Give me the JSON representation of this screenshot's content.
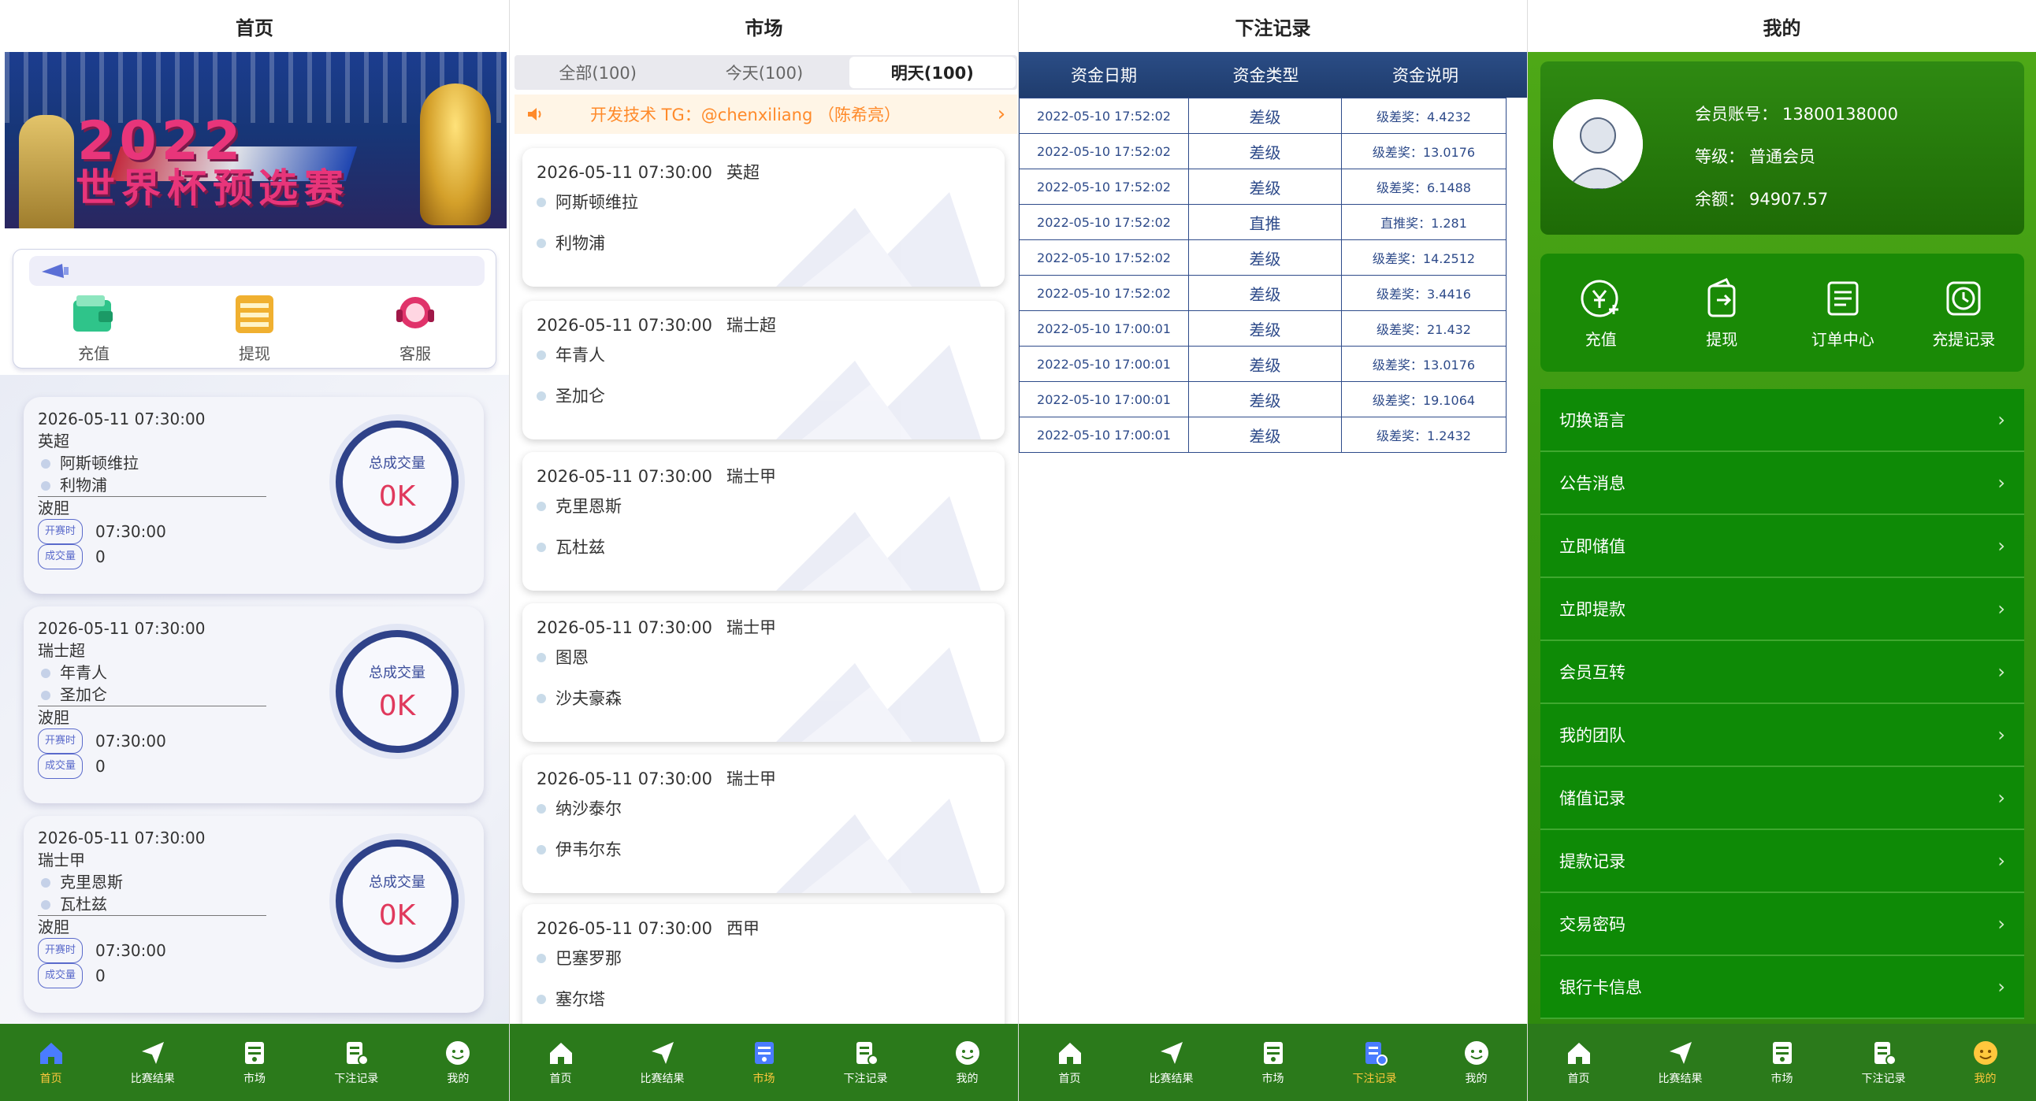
{
  "tabbar": [
    {
      "label": "首页",
      "icon": "home-icon"
    },
    {
      "label": "比赛结果",
      "icon": "paper-plane-icon"
    },
    {
      "label": "市场",
      "icon": "market-icon"
    },
    {
      "label": "下注记录",
      "icon": "record-icon"
    },
    {
      "label": "我的",
      "icon": "face-icon"
    }
  ],
  "home": {
    "title": "首页",
    "banner": {
      "line1": "2022",
      "line2": "世界杯预选赛"
    },
    "quick": [
      {
        "label": "充值",
        "icon": "wallet-icon",
        "color": "#2fc48a"
      },
      {
        "label": "提现",
        "icon": "cards-icon",
        "color": "#f0b030"
      },
      {
        "label": "客服",
        "icon": "headset-icon",
        "color": "#e0336a"
      }
    ],
    "cards": [
      {
        "time": "2026-05-11 07:30:00",
        "league": "英超",
        "team1": "阿斯顿维拉",
        "team2": "利物浦",
        "market": "波胆",
        "tag1": "开赛时",
        "kickoff": "07:30:00",
        "tag2": "成交量",
        "volume": "0",
        "ring_label": "总成交量",
        "ring_value": "0K"
      },
      {
        "time": "2026-05-11 07:30:00",
        "league": "瑞士超",
        "team1": "年青人",
        "team2": "圣加仑",
        "market": "波胆",
        "tag1": "开赛时",
        "kickoff": "07:30:00",
        "tag2": "成交量",
        "volume": "0",
        "ring_label": "总成交量",
        "ring_value": "0K"
      },
      {
        "time": "2026-05-11 07:30:00",
        "league": "瑞士甲",
        "team1": "克里恩斯",
        "team2": "瓦杜兹",
        "market": "波胆",
        "tag1": "开赛时",
        "kickoff": "07:30:00",
        "tag2": "成交量",
        "volume": "0",
        "ring_label": "总成交量",
        "ring_value": "0K"
      }
    ]
  },
  "market": {
    "title": "市场",
    "tabs": [
      {
        "label": "全部(100)"
      },
      {
        "label": "今天(100)"
      },
      {
        "label": "明天(100)",
        "active": true
      }
    ],
    "notice": "开发技术 TG：@chenxiliang （陈希亮）",
    "matches": [
      {
        "time": "2026-05-11 07:30:00",
        "league": "英超",
        "team1": "阿斯顿维拉",
        "team2": "利物浦"
      },
      {
        "time": "2026-05-11 07:30:00",
        "league": "瑞士超",
        "team1": "年青人",
        "team2": "圣加仑"
      },
      {
        "time": "2026-05-11 07:30:00",
        "league": "瑞士甲",
        "team1": "克里恩斯",
        "team2": "瓦杜兹"
      },
      {
        "time": "2026-05-11 07:30:00",
        "league": "瑞士甲",
        "team1": "图恩",
        "team2": "沙夫豪森"
      },
      {
        "time": "2026-05-11 07:30:00",
        "league": "瑞士甲",
        "team1": "纳沙泰尔",
        "team2": "伊韦尔东"
      },
      {
        "time": "2026-05-11 07:30:00",
        "league": "西甲",
        "team1": "巴塞罗那",
        "team2": "塞尔塔"
      }
    ]
  },
  "records": {
    "title": "下注记录",
    "headers": [
      "资金日期",
      "资金类型",
      "资金说明"
    ],
    "rows": [
      [
        "2022-05-10 17:52:02",
        "差级",
        "级差奖：4.4232"
      ],
      [
        "2022-05-10 17:52:02",
        "差级",
        "级差奖：13.0176"
      ],
      [
        "2022-05-10 17:52:02",
        "差级",
        "级差奖：6.1488"
      ],
      [
        "2022-05-10 17:52:02",
        "直推",
        "直推奖：1.281"
      ],
      [
        "2022-05-10 17:52:02",
        "差级",
        "级差奖：14.2512"
      ],
      [
        "2022-05-10 17:52:02",
        "差级",
        "级差奖：3.4416"
      ],
      [
        "2022-05-10 17:00:01",
        "差级",
        "级差奖：21.432"
      ],
      [
        "2022-05-10 17:00:01",
        "差级",
        "级差奖：13.0176"
      ],
      [
        "2022-05-10 17:00:01",
        "差级",
        "级差奖：19.1064"
      ],
      [
        "2022-05-10 17:00:01",
        "差级",
        "级差奖：1.2432"
      ]
    ]
  },
  "mine": {
    "title": "我的",
    "account_label": "会员账号：",
    "account": "13800138000",
    "level_label": "等级：",
    "level": "普通会员",
    "balance_label": "余额：",
    "balance": "94907.57",
    "actions": [
      {
        "label": "充值",
        "icon": "yen-plus-icon"
      },
      {
        "label": "提现",
        "icon": "wallet-withdraw-icon"
      },
      {
        "label": "订单中心",
        "icon": "list-icon"
      },
      {
        "label": "充提记录",
        "icon": "clock-icon"
      }
    ],
    "menu": [
      "切换语言",
      "公告消息",
      "立即储值",
      "立即提款",
      "会员互转",
      "我的团队",
      "储值记录",
      "提款记录",
      "交易密码",
      "银行卡信息"
    ]
  }
}
